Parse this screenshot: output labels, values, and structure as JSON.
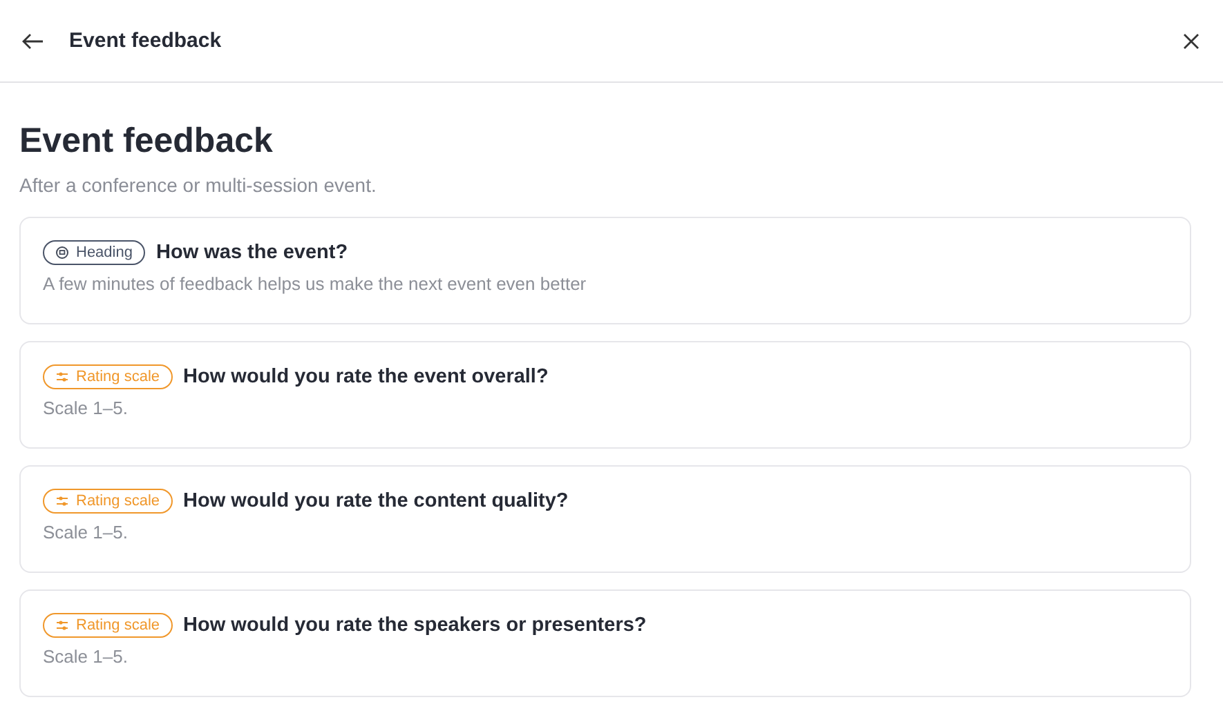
{
  "header": {
    "title": "Event feedback"
  },
  "page": {
    "title": "Event feedback",
    "subtitle": "After a conference or multi-session event."
  },
  "questions": [
    {
      "kind": "heading",
      "tag": "Heading",
      "title": "How was the event?",
      "description": "A few minutes of feedback helps us make the next event even better"
    },
    {
      "kind": "rating",
      "tag": "Rating scale",
      "title": "How would you rate the event overall?",
      "description": "Scale 1–5."
    },
    {
      "kind": "rating",
      "tag": "Rating scale",
      "title": "How would you rate the content quality?",
      "description": "Scale 1–5."
    },
    {
      "kind": "rating",
      "tag": "Rating scale",
      "title": "How would you rate the speakers or presenters?",
      "description": "Scale 1–5."
    }
  ]
}
